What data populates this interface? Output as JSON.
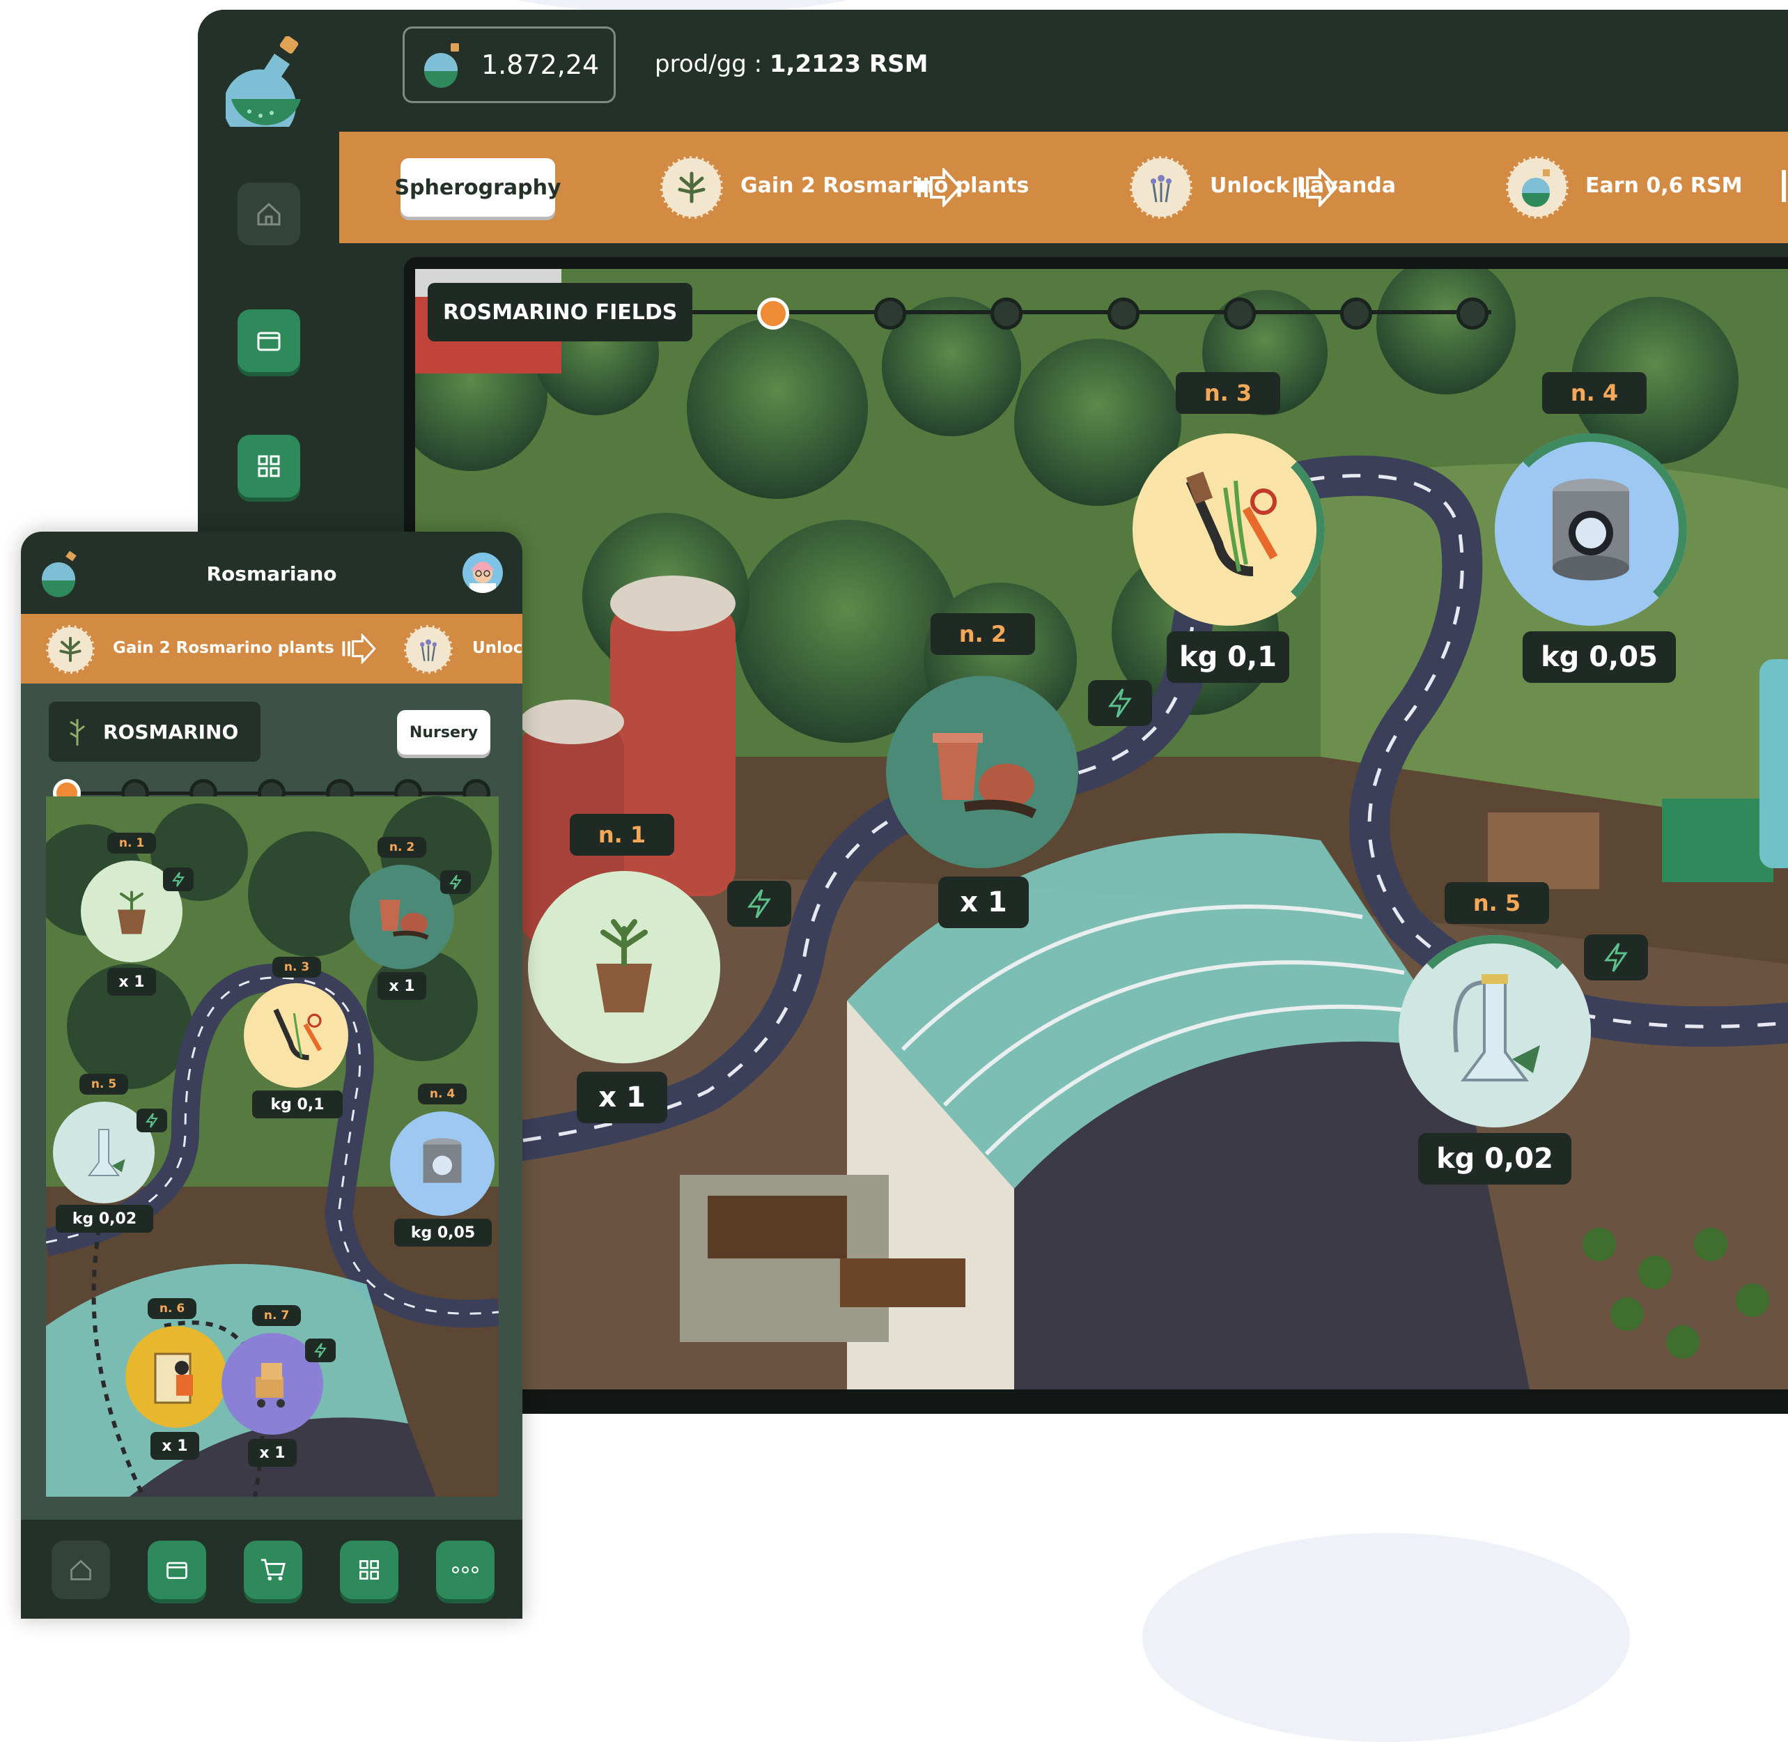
{
  "desktop": {
    "balance": "1.872,24",
    "prod_label": "prod/gg : ",
    "prod_value": "1,2123 RSM",
    "quest_button": "Spherography",
    "quests": [
      "Gain 2 Rosmarino plants",
      "Unlock Lavanda",
      "Earn 0,6 RSM"
    ],
    "map_title": "ROSMARINO FIELDS",
    "nodes": [
      {
        "label": "n. 1",
        "value": "x 1",
        "icon": "seedling-pot-icon"
      },
      {
        "label": "n. 2",
        "value": "x 1",
        "icon": "clay-pots-icon"
      },
      {
        "label": "n. 3",
        "value": "kg 0,1",
        "icon": "pruning-shears-icon"
      },
      {
        "label": "n. 4",
        "value": "kg 0,05",
        "icon": "drum-icon"
      },
      {
        "label": "n. 5",
        "value": "kg 0,02",
        "icon": "distiller-icon"
      }
    ]
  },
  "mobile": {
    "title": "Rosmariano",
    "quests": [
      "Gain 2 Rosmarino plants",
      "Unlocl"
    ],
    "section_title": "ROSMARINO",
    "nursery_button": "Nursery",
    "nodes": [
      {
        "label": "n. 1",
        "value": "x 1"
      },
      {
        "label": "n. 2",
        "value": "x 1"
      },
      {
        "label": "n. 3",
        "value": "kg 0,1"
      },
      {
        "label": "n. 4",
        "value": "kg 0,05"
      },
      {
        "label": "n. 5",
        "value": "kg 0,02"
      },
      {
        "label": "n. 6",
        "value": "x 1"
      },
      {
        "label": "n. 7",
        "value": "x 1"
      }
    ]
  },
  "colors": {
    "dark_green": "#233129",
    "orange": "#d38a42",
    "accent_green": "#2f8a5b",
    "label_orange": "#f5a858"
  }
}
